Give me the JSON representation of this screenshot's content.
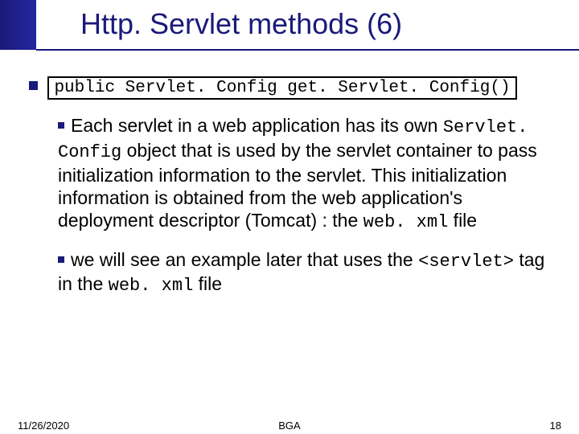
{
  "title": "Http. Servlet methods (6)",
  "method": {
    "signature": "public Servlet. Config get. Servlet. Config()"
  },
  "bullets": {
    "item1": {
      "part1": "Each servlet in a web application has its own ",
      "code1": "Servlet. Config",
      "part2": " object that is used by the servlet container to pass initialization information to the servlet. This initialization information is obtained from the web application's deployment descriptor (Tomcat) : the ",
      "code2": "web. xml",
      "part3": " file"
    },
    "item2": {
      "part1": "we will see an example later that uses the ",
      "code1": "<servlet>",
      "part2": " tag in the ",
      "code2": "web. xml",
      "part3": " file"
    }
  },
  "footer": {
    "date": "11/26/2020",
    "center": "BGA",
    "page": "18"
  }
}
